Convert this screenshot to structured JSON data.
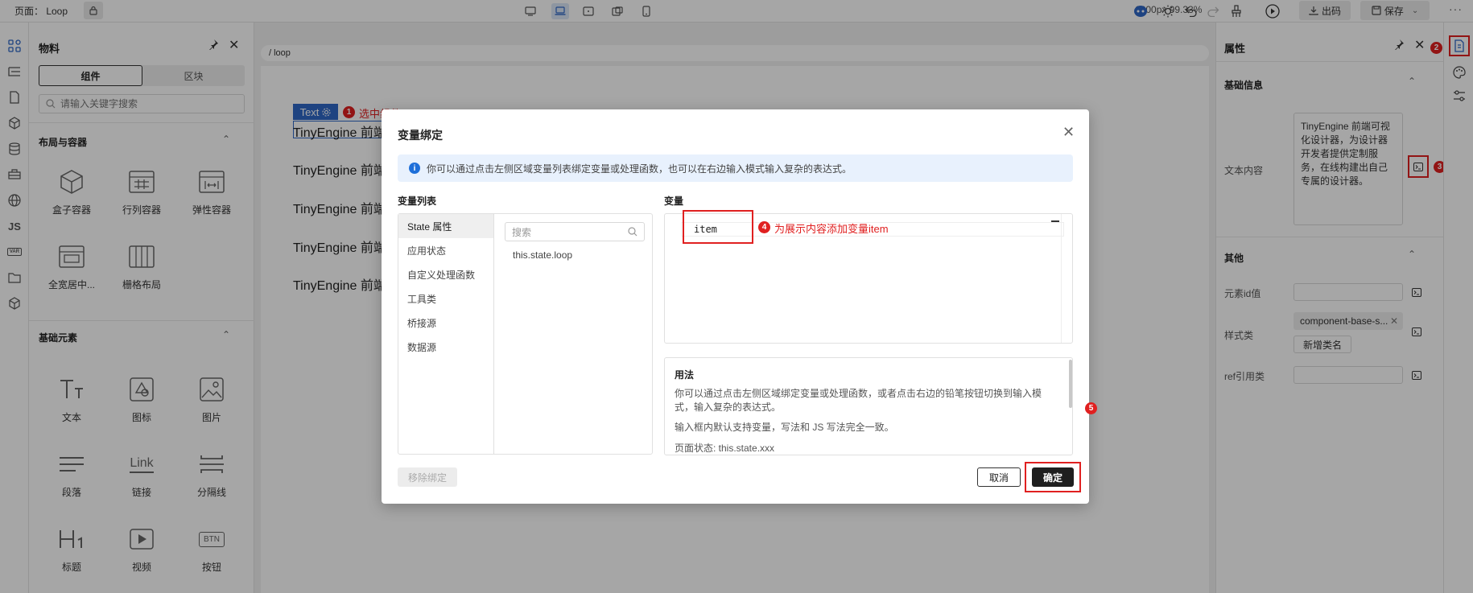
{
  "topbar": {
    "page_label": "页面： Loop",
    "size": "1200px  99.33%",
    "publish": "出码",
    "save": "保存"
  },
  "rail": {
    "js_label": "JS",
    "var_label": "VAR"
  },
  "material": {
    "title": "物料",
    "tabs": [
      "组件",
      "区块"
    ],
    "search_placeholder": "请输入关键字搜索",
    "layout_section": "布局与容器",
    "layout_items": [
      "盒子容器",
      "行列容器",
      "弹性容器",
      "全宽居中...",
      "栅格布局"
    ],
    "basic_section": "基础元素",
    "basic_items": [
      "文本",
      "图标",
      "图片",
      "段落",
      "链接",
      "分隔线",
      "标题",
      "视频",
      "按钮"
    ],
    "link_icon_text": "Link",
    "btn_icon_text": "BTN"
  },
  "canvas": {
    "breadcrumb": "/ loop",
    "badge": "Text",
    "anno1": "选中组件",
    "lines": [
      "TinyEngine 前端可视化设计器，为设计器开发者提供定制服务，在线构建出自己专属的设计器。",
      "TinyEngine 前端",
      "TinyEngine 前端",
      "TinyEngine 前端",
      "TinyEngine 前端"
    ]
  },
  "props": {
    "title": "属性",
    "basic_section": "基础信息",
    "text_label": "文本内容",
    "text_value": "TinyEngine 前端可视化设计器，为设计器开发者提供定制服务，在线构建出自己专属的设计器。",
    "other_section": "其他",
    "id_label": "元素id值",
    "class_label": "样式类",
    "class_tag": "component-base-s...",
    "add_class": "新增类名",
    "ref_label": "ref引用类"
  },
  "annotations": {
    "n1": "1",
    "n2": "2",
    "n3": "3",
    "n4": "4",
    "n5": "5",
    "anno4": "为展示内容添加变量item"
  },
  "modal": {
    "title": "变量绑定",
    "info": "你可以通过点击左侧区域变量列表绑定变量或处理函数，也可以在右边输入模式输入复杂的表达式。",
    "var_list_label": "变量列表",
    "var_label": "变量",
    "categories": [
      "State 属性",
      "应用状态",
      "自定义处理函数",
      "工具类",
      "桥接源",
      "数据源"
    ],
    "search_placeholder": "搜索",
    "state_item": "this.state.loop",
    "editor_value": "item",
    "usage_title": "用法",
    "usage_p1": "你可以通过点击左侧区域绑定变量或处理函数，或者点击右边的铅笔按钮切换到输入模式，输入复杂的表达式。",
    "usage_p2": "输入框内默认支持变量，写法和 JS 写法完全一致。",
    "usage_p3": "页面状态: this.state.xxx",
    "remove": "移除绑定",
    "cancel": "取消",
    "ok": "确定"
  }
}
